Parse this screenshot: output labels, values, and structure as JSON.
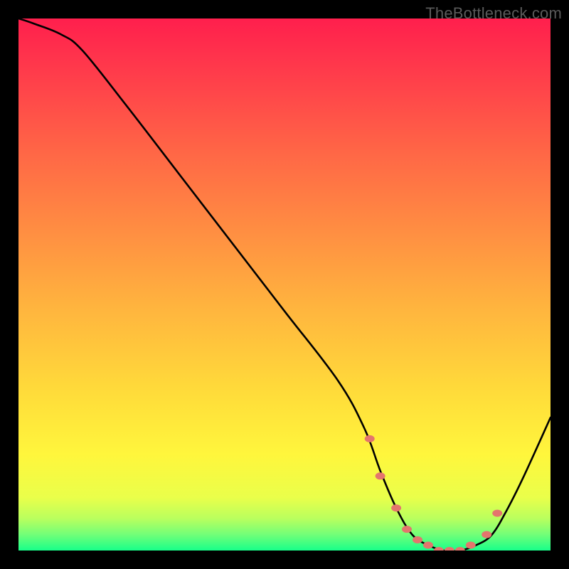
{
  "watermark": "TheBottleneck.com",
  "colors": {
    "gradient_stops": [
      {
        "offset": 0.0,
        "color": "#ff1f4d"
      },
      {
        "offset": 0.1,
        "color": "#ff3b4b"
      },
      {
        "offset": 0.25,
        "color": "#ff6646"
      },
      {
        "offset": 0.4,
        "color": "#ff8e42"
      },
      {
        "offset": 0.55,
        "color": "#ffb63e"
      },
      {
        "offset": 0.7,
        "color": "#ffdb3a"
      },
      {
        "offset": 0.82,
        "color": "#fff63c"
      },
      {
        "offset": 0.9,
        "color": "#eaff4a"
      },
      {
        "offset": 0.94,
        "color": "#b9ff5e"
      },
      {
        "offset": 0.97,
        "color": "#72ff78"
      },
      {
        "offset": 1.0,
        "color": "#18ff8a"
      }
    ],
    "curve": "#000000",
    "marker": "#e4756d",
    "frame_bg": "#000000"
  },
  "chart_data": {
    "type": "line",
    "title": "",
    "xlabel": "",
    "ylabel": "",
    "xlim": [
      0,
      100
    ],
    "ylim": [
      0,
      100
    ],
    "grid": false,
    "legend": false,
    "series": [
      {
        "name": "curve",
        "x": [
          0,
          3,
          8,
          12,
          20,
          30,
          40,
          50,
          60,
          65,
          68,
          71,
          74,
          77,
          80,
          83,
          86,
          89,
          92,
          95,
          100
        ],
        "values": [
          100,
          99,
          97,
          94,
          84,
          71,
          58,
          45,
          32,
          23,
          15,
          8,
          3,
          1,
          0,
          0,
          1,
          3,
          8,
          14,
          25
        ]
      }
    ],
    "markers": {
      "name": "highlighted-points",
      "x": [
        66,
        68,
        71,
        73,
        75,
        77,
        79,
        81,
        83,
        85,
        88,
        90
      ],
      "values": [
        21,
        14,
        8,
        4,
        2,
        1,
        0,
        0,
        0,
        1,
        3,
        7
      ]
    }
  }
}
